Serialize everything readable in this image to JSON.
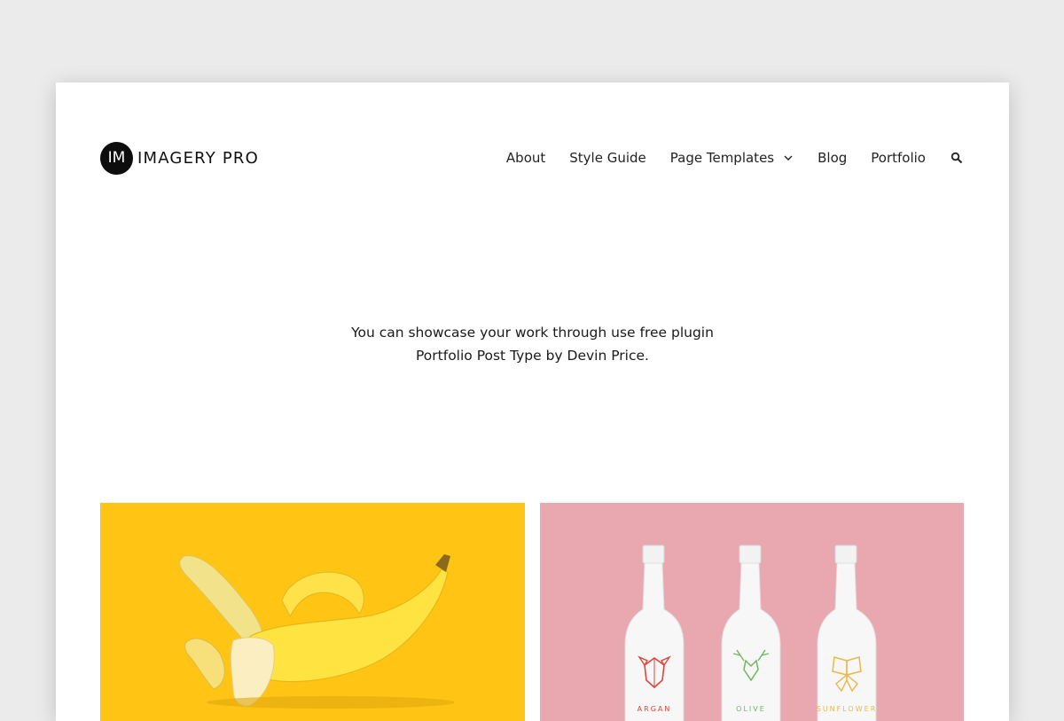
{
  "header": {
    "logo_badge": "IM",
    "logo_text": "IMAGERY PRO",
    "nav": [
      {
        "label": "About"
      },
      {
        "label": "Style Guide"
      },
      {
        "label": "Page Templates"
      },
      {
        "label": "Blog"
      },
      {
        "label": "Portfolio"
      }
    ]
  },
  "intro": {
    "line1": "You can showcase your work through use free plugin",
    "line2": "Portfolio Post Type by Devin Price."
  },
  "portfolio": {
    "items": [
      {
        "background": "#ffc414",
        "subject": "banana"
      },
      {
        "background": "#e9a8b0",
        "subject": "bottles",
        "labels": [
          "ARGAN",
          "OLIVE",
          "SUNFLOWER"
        ]
      }
    ]
  },
  "colors": {
    "page_bg": "#ebebeb",
    "card_bg": "#ffffff",
    "logo": "#0d0d0d",
    "text": "#222222"
  },
  "icons": {
    "dropdown": "chevron-down-icon",
    "search": "search-icon"
  }
}
